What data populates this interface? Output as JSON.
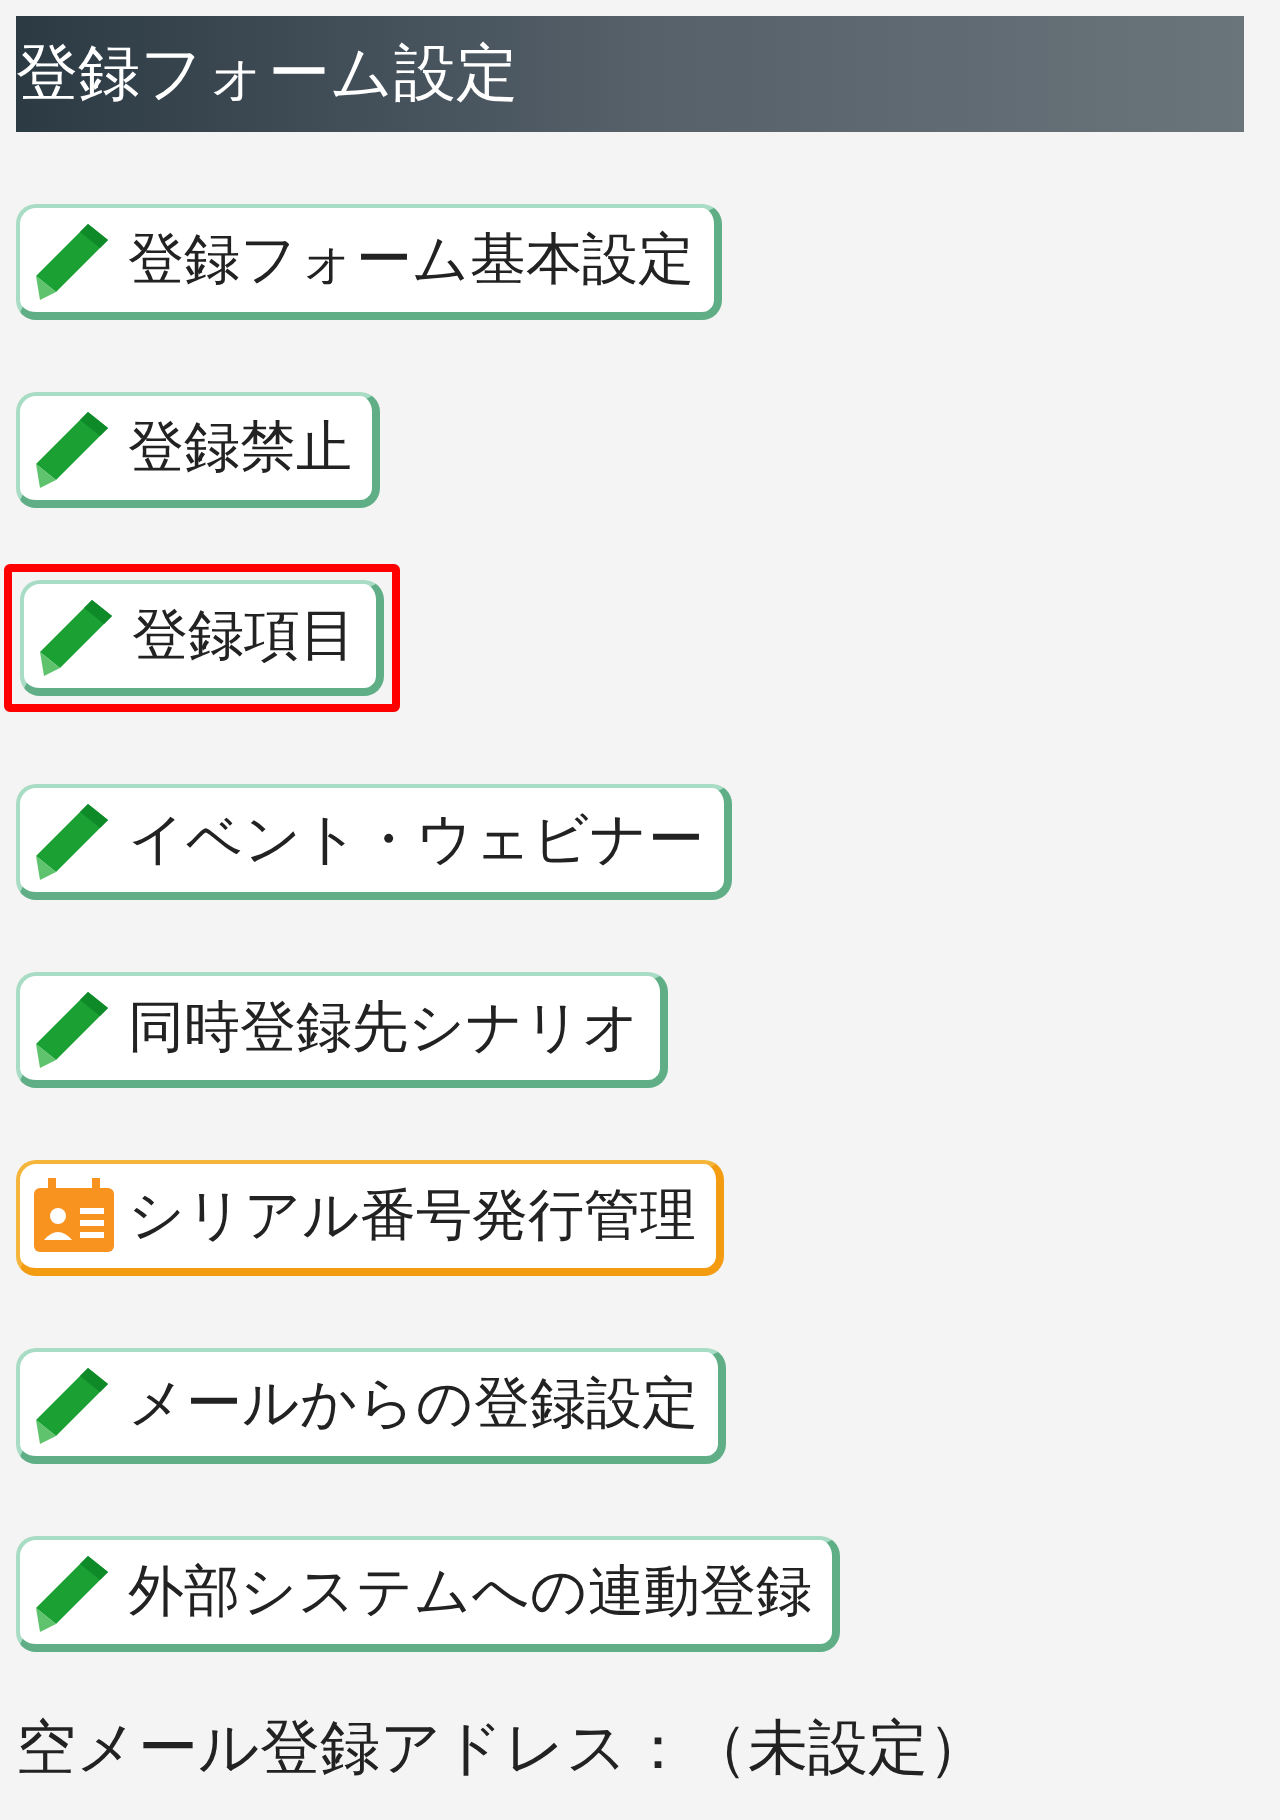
{
  "title": "登録フォーム設定",
  "buttons": [
    {
      "label": "登録フォーム基本設定",
      "kind": "edit",
      "highlighted": false
    },
    {
      "label": "登録禁止",
      "kind": "edit",
      "highlighted": false
    },
    {
      "label": "登録項目",
      "kind": "edit",
      "highlighted": true
    },
    {
      "label": "イベント・ウェビナー",
      "kind": "edit",
      "highlighted": false
    },
    {
      "label": "同時登録先シナリオ",
      "kind": "edit",
      "highlighted": false
    },
    {
      "label": "シリアル番号発行管理",
      "kind": "card",
      "highlighted": false
    },
    {
      "label": "メールからの登録設定",
      "kind": "edit",
      "highlighted": false
    },
    {
      "label": "外部システムへの連動登録",
      "kind": "edit",
      "highlighted": false
    }
  ],
  "footer": "空メール登録アドレス：（未設定）"
}
